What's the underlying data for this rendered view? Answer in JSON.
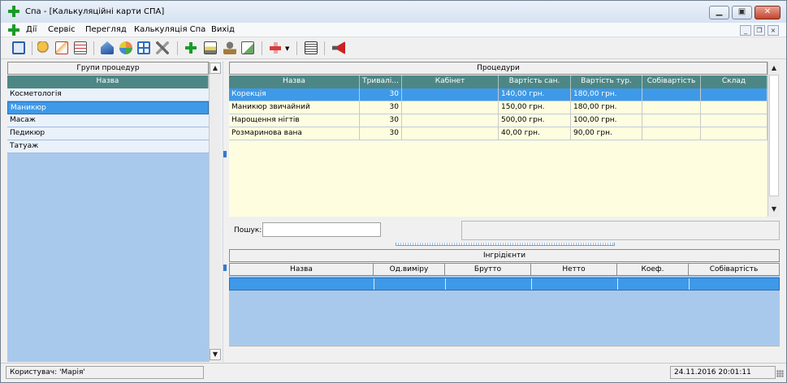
{
  "window": {
    "title": "Спа - [Калькуляційні карти СПА]",
    "min_glyph": "▁",
    "max_glyph": "▣",
    "close_glyph": "✕"
  },
  "menu": {
    "items": [
      "Дії",
      "Сервіс",
      "Перегляд",
      "Калькуляція Спа",
      "Вихід"
    ],
    "mdi_min": "_",
    "mdi_restore": "❐",
    "mdi_close": "×"
  },
  "toolbar": {
    "icons": [
      "window-icon",
      "find-person-icon",
      "mail-icon",
      "report-icon",
      "warehouse-icon",
      "palette-icon",
      "table-icon",
      "tools-icon",
      "add-icon",
      "print-icon",
      "stamp-icon",
      "export-icon",
      "delete-icon",
      "calculator-icon",
      "speaker-icon"
    ]
  },
  "groups": {
    "header": "Групи процедур",
    "column": "Назва",
    "items": [
      "Косметологія",
      "Маникюр",
      "Масаж",
      "Педикюр",
      "Татуаж"
    ],
    "selected_index": 1
  },
  "procedures": {
    "header": "Процедури",
    "columns": [
      "Назва",
      "Тривалі...",
      "Кабінет",
      "Вартість сан.",
      "Вартість тур.",
      "Собівартість",
      "Склад"
    ],
    "rows": [
      [
        "Корекція",
        "30",
        "",
        "140,00 грн.",
        "180,00 грн.",
        "",
        ""
      ],
      [
        "Маникюр звичайний",
        "30",
        "",
        "150,00 грн.",
        "180,00 грн.",
        "",
        ""
      ],
      [
        "Нарощення нігтів",
        "30",
        "",
        "500,00 грн.",
        "100,00 грн.",
        "",
        ""
      ],
      [
        "Розмаринова вана",
        "30",
        "",
        "40,00 грн.",
        "90,00 грн.",
        "",
        ""
      ]
    ],
    "selected_index": 0
  },
  "search": {
    "label": "Пошук:",
    "value": ""
  },
  "ingredients": {
    "header": "Інгрідієнти",
    "columns": [
      "Назва",
      "Од.виміру",
      "Брутто",
      "Нетто",
      "Коеф.",
      "Собівартість"
    ]
  },
  "status": {
    "user": "Користувач:  'Марія'",
    "datetime": "24.11.2016 20:01:11"
  },
  "colors": {
    "grid_header": "#4d8785",
    "selection": "#3e99e8",
    "procedures_bg": "#fffde0",
    "groups_bg": "#a9c9ec"
  }
}
